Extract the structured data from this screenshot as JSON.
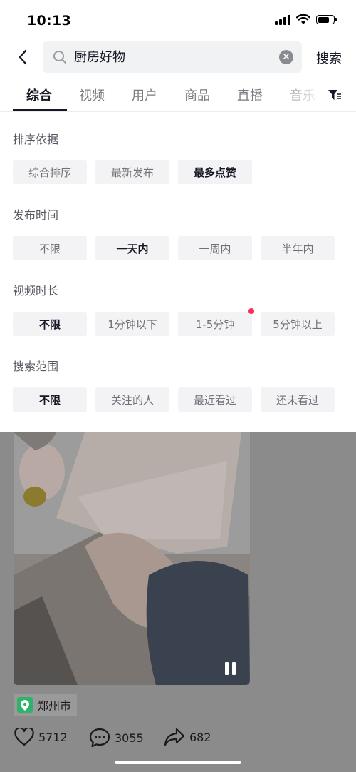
{
  "status_bar": {
    "time": "10:13"
  },
  "search": {
    "query": "厨房好物",
    "button_label": "搜索"
  },
  "tabs": [
    {
      "label": "综合",
      "active": true
    },
    {
      "label": "视频"
    },
    {
      "label": "用户"
    },
    {
      "label": "商品"
    },
    {
      "label": "直播"
    },
    {
      "label": "音乐"
    }
  ],
  "filters": {
    "sort": {
      "title": "排序依据",
      "options": [
        "综合排序",
        "最新发布",
        "最多点赞"
      ],
      "selected": "最多点赞"
    },
    "time": {
      "title": "发布时间",
      "options": [
        "不限",
        "一天内",
        "一周内",
        "半年内"
      ],
      "selected": "一天内"
    },
    "duration": {
      "title": "视频时长",
      "options": [
        "不限",
        "1分钟以下",
        "1-5分钟",
        "5分钟以上"
      ],
      "selected": "不限"
    },
    "scope": {
      "title": "搜索范围",
      "options": [
        "不限",
        "关注的人",
        "最近看过",
        "还未看过"
      ],
      "selected": "不限"
    }
  },
  "video": {
    "location": "郑州市",
    "likes": "5712",
    "comments": "3055",
    "shares": "682"
  },
  "colors": {
    "accent": "#fe2c55",
    "location_green": "#2fb36a"
  }
}
